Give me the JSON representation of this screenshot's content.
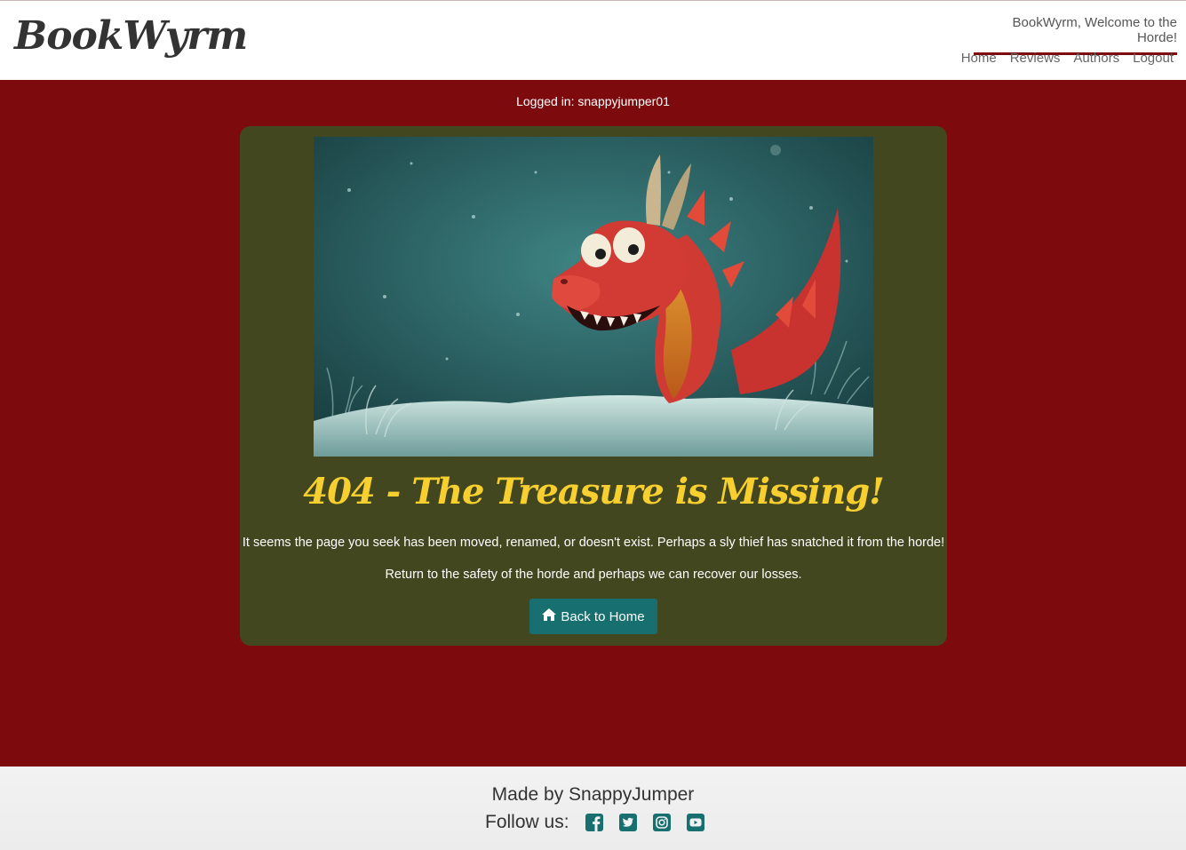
{
  "header": {
    "brand": "BookWyrm",
    "welcome": "BookWyrm, Welcome to the Horde!",
    "nav": [
      "Home",
      "Reviews",
      "Authors",
      "Logout"
    ]
  },
  "status": {
    "logged_in": "Logged in: snappyjumper01"
  },
  "error_card": {
    "title": "404 - The Treasure is Missing!",
    "message1": "It seems the page you seek has been moved, renamed, or doesn't exist. Perhaps a sly thief has snatched it from the horde!",
    "message2": "Return to the safety of the horde and perhaps we can recover our losses.",
    "button_label": "Back to Home",
    "button_icon": "home-icon"
  },
  "footer": {
    "made_by": "Made by SnappyJumper",
    "follow_label": "Follow us:",
    "social": [
      "facebook-icon",
      "twitter-icon",
      "instagram-icon",
      "youtube-icon"
    ]
  },
  "colors": {
    "page_bg": "#7d0b0e",
    "card_bg": "#434720",
    "title": "#f7cf2e",
    "button": "#17706f",
    "social_icons": "#17706f"
  }
}
